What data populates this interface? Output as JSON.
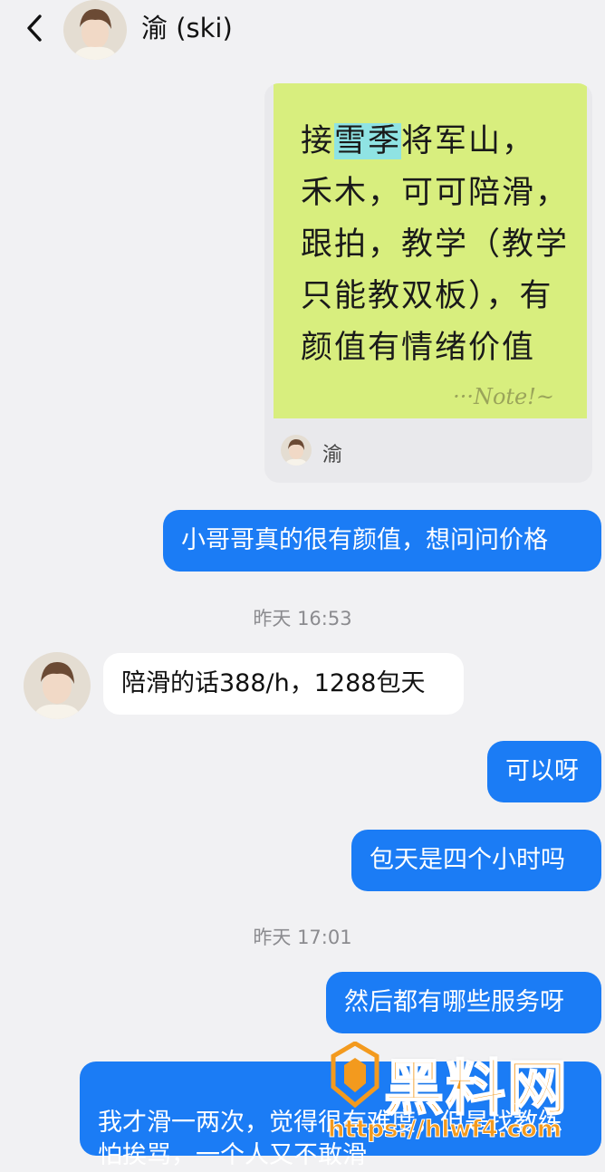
{
  "header": {
    "back_icon": "chevron-left-icon",
    "contact_name": "渝 (ski)"
  },
  "shared_card": {
    "note_text_pre": "接",
    "note_text_highlight": "雪季",
    "note_text_post": "将军山，\n禾木，可可陪滑，\n跟拍，教学（教学\n只能教双板），有\n颜值有情绪价值",
    "note_signature": "···Note!~",
    "author": "渝"
  },
  "messages": [
    {
      "side": "out",
      "text": "小哥哥真的很有颜值，想问问价格"
    },
    {
      "side": "time",
      "text": "昨天 16:53"
    },
    {
      "side": "in",
      "text": "陪滑的话388/h，1288包天"
    },
    {
      "side": "out",
      "text": "可以呀"
    },
    {
      "side": "out",
      "text": "包天是四个小时吗"
    },
    {
      "side": "time",
      "text": "昨天 17:01"
    },
    {
      "side": "out",
      "text": "然后都有哪些服务呀"
    },
    {
      "side": "out",
      "text": "我才滑一两次，觉得很有难度，但是找教练\n怕挨骂，一个人又不敢滑"
    }
  ],
  "watermark": {
    "title": "黑料网",
    "url": "https://hlwf4.com"
  },
  "colors": {
    "outgoing_bubble": "#1b7cf5",
    "incoming_bubble": "#ffffff",
    "background": "#f1f1f3",
    "note_paper": "#d8ee7e",
    "watermark": "#f39a1e"
  }
}
